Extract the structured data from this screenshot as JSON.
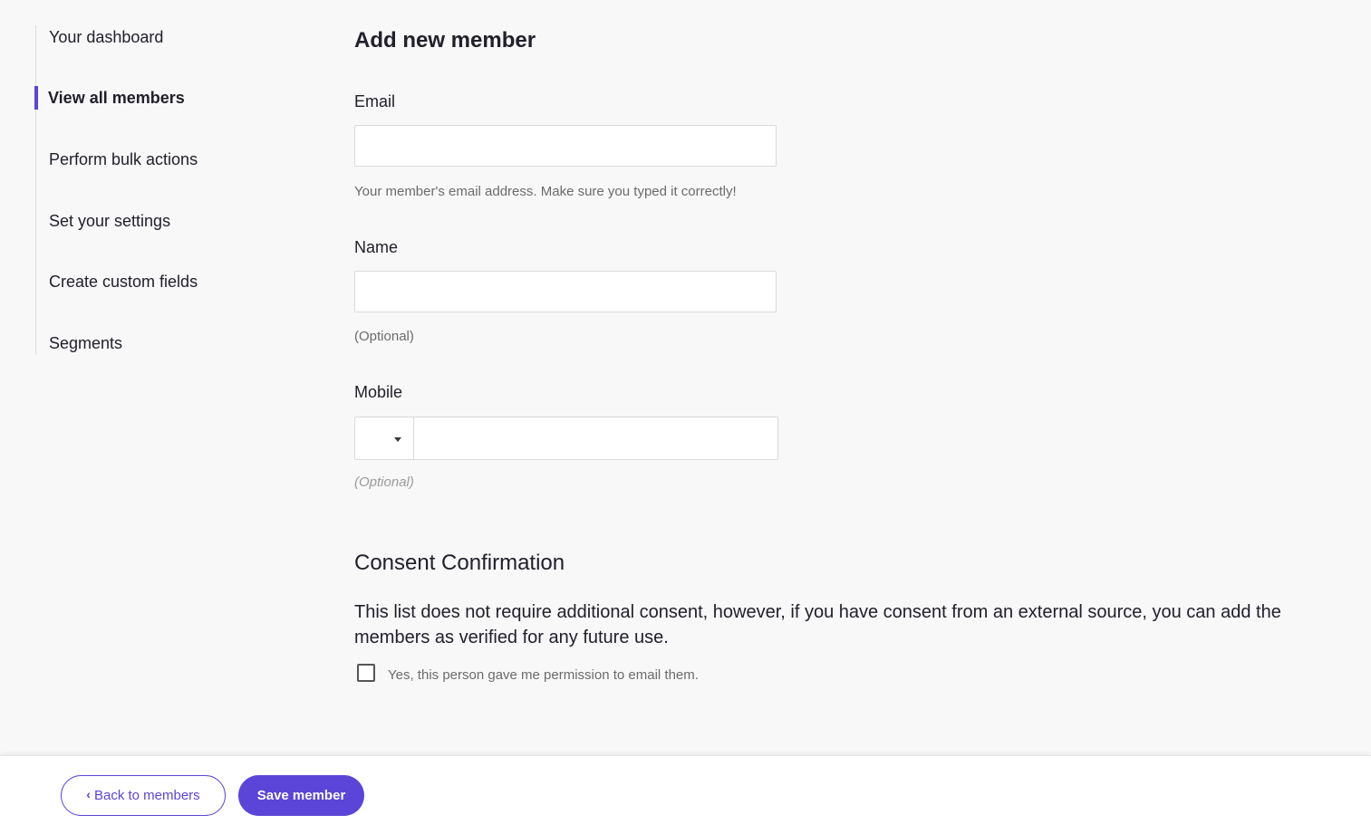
{
  "sidebar": {
    "items": [
      {
        "label": "Your dashboard"
      },
      {
        "label": "View all members"
      },
      {
        "label": "Perform bulk actions"
      },
      {
        "label": "Set your settings"
      },
      {
        "label": "Create custom fields"
      },
      {
        "label": "Segments"
      }
    ],
    "accent_color": "#5a45d8"
  },
  "form": {
    "title": "Add new member",
    "email": {
      "label": "Email",
      "value": "",
      "hint": "Your member's email address. Make sure you typed it correctly!"
    },
    "name": {
      "label": "Name",
      "value": "",
      "hint": "(Optional)"
    },
    "mobile": {
      "label": "Mobile",
      "country_code": "",
      "value": "",
      "hint": "(Optional)"
    }
  },
  "consent": {
    "title": "Consent Confirmation",
    "text": "This list does not require additional consent, however, if you have consent from an external source, you can add the members as verified for any future use.",
    "checkbox_label": "Yes, this person gave me permission to email them.",
    "checked": false
  },
  "footer": {
    "back_label": "Back to members",
    "save_label": "Save member",
    "primary_color": "#5a45d8"
  }
}
